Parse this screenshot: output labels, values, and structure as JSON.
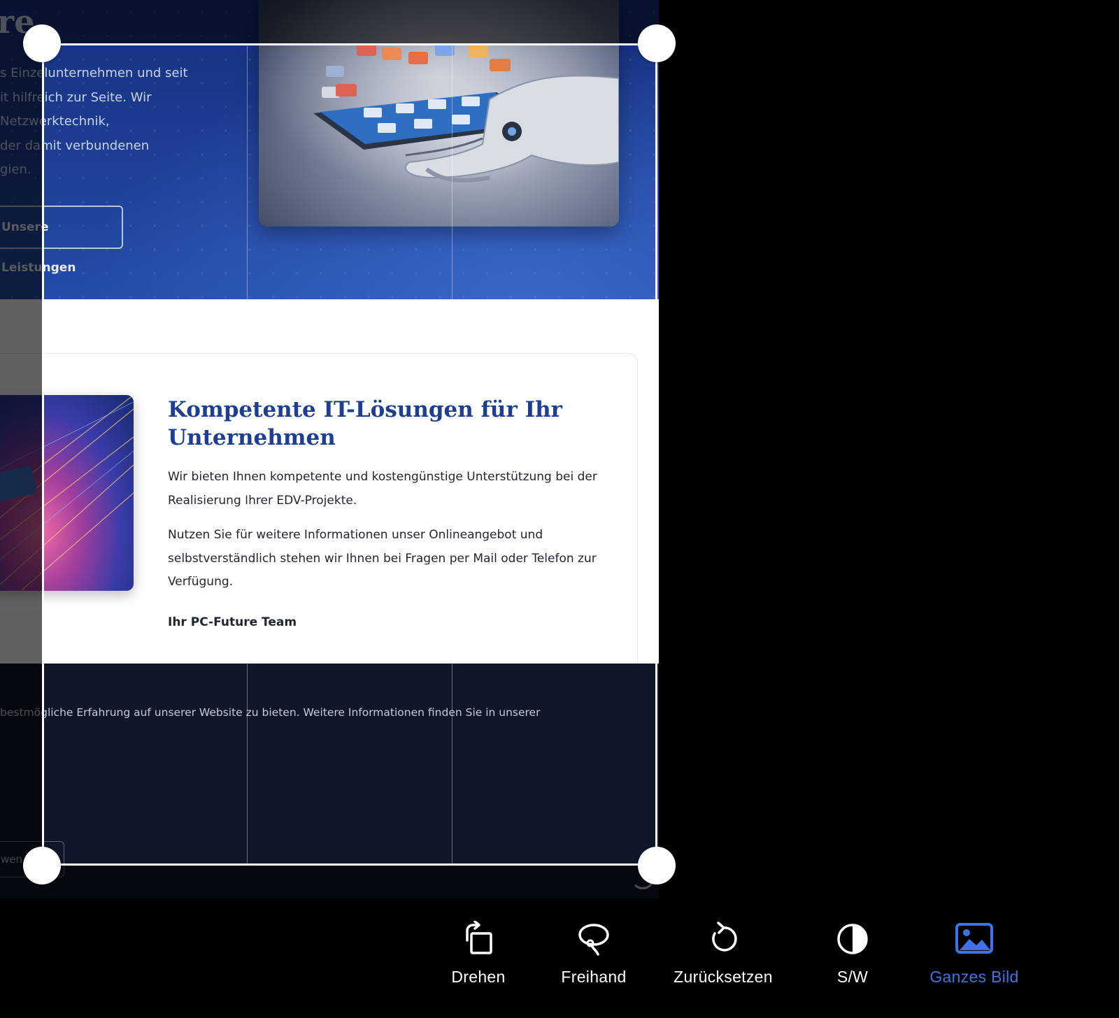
{
  "webpage": {
    "hero": {
      "heading_fragment": "re",
      "lines": [
        "s Einzelunternehmen und seit",
        "it hilfreich zur Seite. Wir",
        " Netzwerktechnik,",
        "der damit verbundenen",
        "gien."
      ],
      "button": "Unsere Leistungen"
    },
    "card": {
      "title": "Kompetente IT-Lösungen für Ihr Unternehmen",
      "p1": "Wir bieten Ihnen kompetente und kostengünstige Unterstützung bei der Realisierung Ihrer EDV-Projekte.",
      "p2": "Nutzen Sie für weitere Informationen unser Onlineangebot und selbstverständlich stehen wir Ihnen bei Fragen per Mail oder Telefon zur Verfügung.",
      "signature": "Ihr PC-Future Team"
    },
    "cookie": {
      "text": "bestmögliche Erfahrung auf unserer Website zu bieten. Weitere Informationen finden Sie in unserer",
      "button_fragment": "wen"
    }
  },
  "toolbar": {
    "items": [
      {
        "label": "Drehen",
        "icon": "rotate-icon"
      },
      {
        "label": "Freihand",
        "icon": "lasso-icon"
      },
      {
        "label": "Zurücksetzen",
        "icon": "reset-icon"
      },
      {
        "label": "S/W",
        "icon": "contrast-icon"
      },
      {
        "label": "Ganzes Bild",
        "icon": "image-icon",
        "active": true
      }
    ]
  },
  "colors": {
    "accent": "#3d73e8",
    "hero_blue": "#244ca8",
    "title_blue": "#1c3f95",
    "footer_navy": "#0f1729"
  }
}
